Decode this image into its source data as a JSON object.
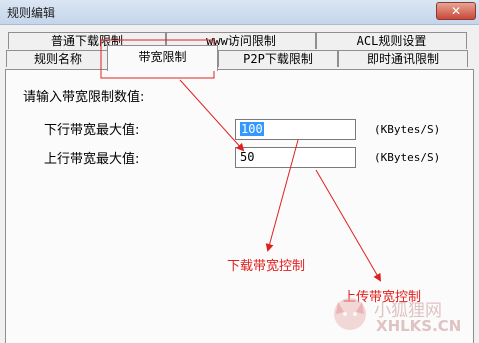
{
  "window": {
    "title": "规则编辑",
    "close_glyph": "✕"
  },
  "tabs": {
    "row1": [
      "普通下载限制",
      "www访问限制",
      "ACL规则设置"
    ],
    "row2": [
      "规则名称",
      "带宽限制",
      "P2P下载限制",
      "即时通讯限制"
    ],
    "active": "带宽限制"
  },
  "form": {
    "prompt": "请输入带宽限制数值:",
    "download": {
      "label": "下行带宽最大值:",
      "value": "100",
      "unit": "(KBytes/S)"
    },
    "upload": {
      "label": "上行带宽最大值:",
      "value": "50",
      "unit": "(KBytes/S)"
    }
  },
  "annotations": {
    "download_control": "下载带宽控制",
    "upload_control": "上传带宽控制",
    "color": "#e0201f"
  },
  "watermark": {
    "name": "小狐狸网",
    "url": "XHLKS.CN"
  }
}
